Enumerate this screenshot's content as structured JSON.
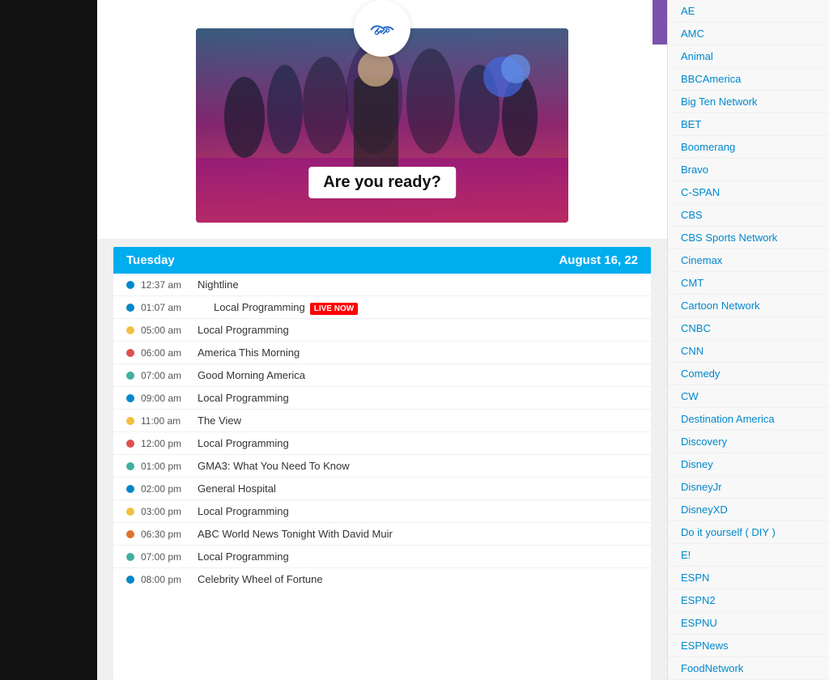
{
  "leftPanel": {},
  "hero": {
    "logoAlt": "handshake-logo",
    "overlayText": "Are you ready?",
    "purpleBar": true
  },
  "schedule": {
    "dayLabel": "Tuesday",
    "dateLabel": "August 16, 22",
    "rows": [
      {
        "time": "12:37 am",
        "show": "Nightline",
        "dotColor": "dot-blue",
        "live": false,
        "indented": false
      },
      {
        "time": "01:07 am",
        "show": "Local Programming",
        "dotColor": "dot-blue",
        "live": true,
        "indented": true
      },
      {
        "time": "05:00 am",
        "show": "Local Programming",
        "dotColor": "dot-yellow",
        "live": false,
        "indented": false
      },
      {
        "time": "06:00 am",
        "show": "America This Morning",
        "dotColor": "dot-red",
        "live": false,
        "indented": false
      },
      {
        "time": "07:00 am",
        "show": "Good Morning America",
        "dotColor": "dot-teal",
        "live": false,
        "indented": false
      },
      {
        "time": "09:00 am",
        "show": "Local Programming",
        "dotColor": "dot-blue",
        "live": false,
        "indented": false
      },
      {
        "time": "11:00 am",
        "show": "The View",
        "dotColor": "dot-yellow",
        "live": false,
        "indented": false
      },
      {
        "time": "12:00 pm",
        "show": "Local Programming",
        "dotColor": "dot-red",
        "live": false,
        "indented": false
      },
      {
        "time": "01:00 pm",
        "show": "GMA3: What You Need To Know",
        "dotColor": "dot-teal",
        "live": false,
        "indented": false
      },
      {
        "time": "02:00 pm",
        "show": "General Hospital",
        "dotColor": "dot-blue",
        "live": false,
        "indented": false
      },
      {
        "time": "03:00 pm",
        "show": "Local Programming",
        "dotColor": "dot-yellow",
        "live": false,
        "indented": false
      },
      {
        "time": "06:30 pm",
        "show": "ABC World News Tonight With David Muir",
        "dotColor": "dot-orange",
        "live": false,
        "indented": false
      },
      {
        "time": "07:00 pm",
        "show": "Local Programming",
        "dotColor": "dot-teal",
        "live": false,
        "indented": false
      },
      {
        "time": "08:00 pm",
        "show": "Celebrity Wheel of Fortune",
        "dotColor": "dot-blue",
        "live": false,
        "indented": false
      }
    ],
    "liveBadgeText": "LIVE NOW"
  },
  "sidebar": {
    "items": [
      {
        "label": "AE"
      },
      {
        "label": "AMC"
      },
      {
        "label": "Animal"
      },
      {
        "label": "BBCAmerica"
      },
      {
        "label": "Big Ten Network"
      },
      {
        "label": "BET"
      },
      {
        "label": "Boomerang"
      },
      {
        "label": "Bravo"
      },
      {
        "label": "C-SPAN"
      },
      {
        "label": "CBS"
      },
      {
        "label": "CBS Sports Network"
      },
      {
        "label": "Cinemax"
      },
      {
        "label": "CMT"
      },
      {
        "label": "Cartoon Network"
      },
      {
        "label": "CNBC"
      },
      {
        "label": "CNN"
      },
      {
        "label": "Comedy"
      },
      {
        "label": "CW"
      },
      {
        "label": "Destination America"
      },
      {
        "label": "Discovery"
      },
      {
        "label": "Disney"
      },
      {
        "label": "DisneyJr"
      },
      {
        "label": "DisneyXD"
      },
      {
        "label": "Do it yourself ( DIY )"
      },
      {
        "label": "E!"
      },
      {
        "label": "ESPN"
      },
      {
        "label": "ESPN2"
      },
      {
        "label": "ESPNU"
      },
      {
        "label": "ESPNews"
      },
      {
        "label": "FoodNetwork"
      }
    ]
  }
}
